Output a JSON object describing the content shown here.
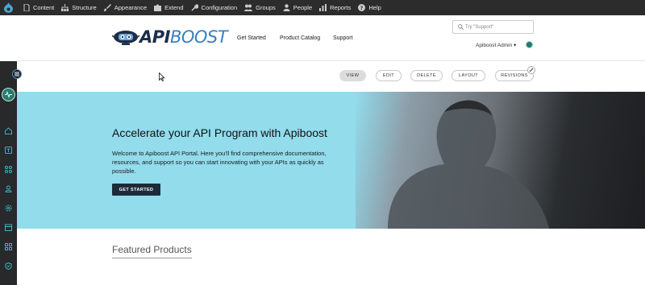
{
  "admin_bar": {
    "items": [
      {
        "label": "Content",
        "icon": "file-icon"
      },
      {
        "label": "Structure",
        "icon": "structure-icon"
      },
      {
        "label": "Appearance",
        "icon": "brush-icon"
      },
      {
        "label": "Extend",
        "icon": "puzzle-icon"
      },
      {
        "label": "Configuration",
        "icon": "wrench-icon"
      },
      {
        "label": "Groups",
        "icon": "groups-icon"
      },
      {
        "label": "People",
        "icon": "people-icon"
      },
      {
        "label": "Reports",
        "icon": "reports-icon"
      },
      {
        "label": "Help",
        "icon": "help-icon"
      }
    ]
  },
  "header": {
    "logo_part1": "API",
    "logo_part2": "BOOST",
    "nav": [
      "Get Started",
      "Product Catalog",
      "Support"
    ],
    "search_placeholder": "Try \"Support\"",
    "user_menu": "Apiboost Admin ▾"
  },
  "tabs": [
    "VIEW",
    "EDIT",
    "DELETE",
    "LAYOUT",
    "REVISIONS"
  ],
  "active_tab": "VIEW",
  "hero": {
    "title": "Accelerate your API Program with Apiboost",
    "text": "Welcome to Apiboost API Portal. Here you'll find comprehensive documentation, resources, and support so you can start innovating with your APIs as quickly as possible.",
    "button": "GET STARTED"
  },
  "featured_title": "Featured Products",
  "colors": {
    "admin_bar": "#2c2c2c",
    "sidebar": "#27292b",
    "hero_bg": "#92dcec",
    "button": "#1c2b3a",
    "logo_dark": "#1d2d4a",
    "logo_blue": "#3b7fc1",
    "sidebar_icon": "#3ab4c4"
  }
}
